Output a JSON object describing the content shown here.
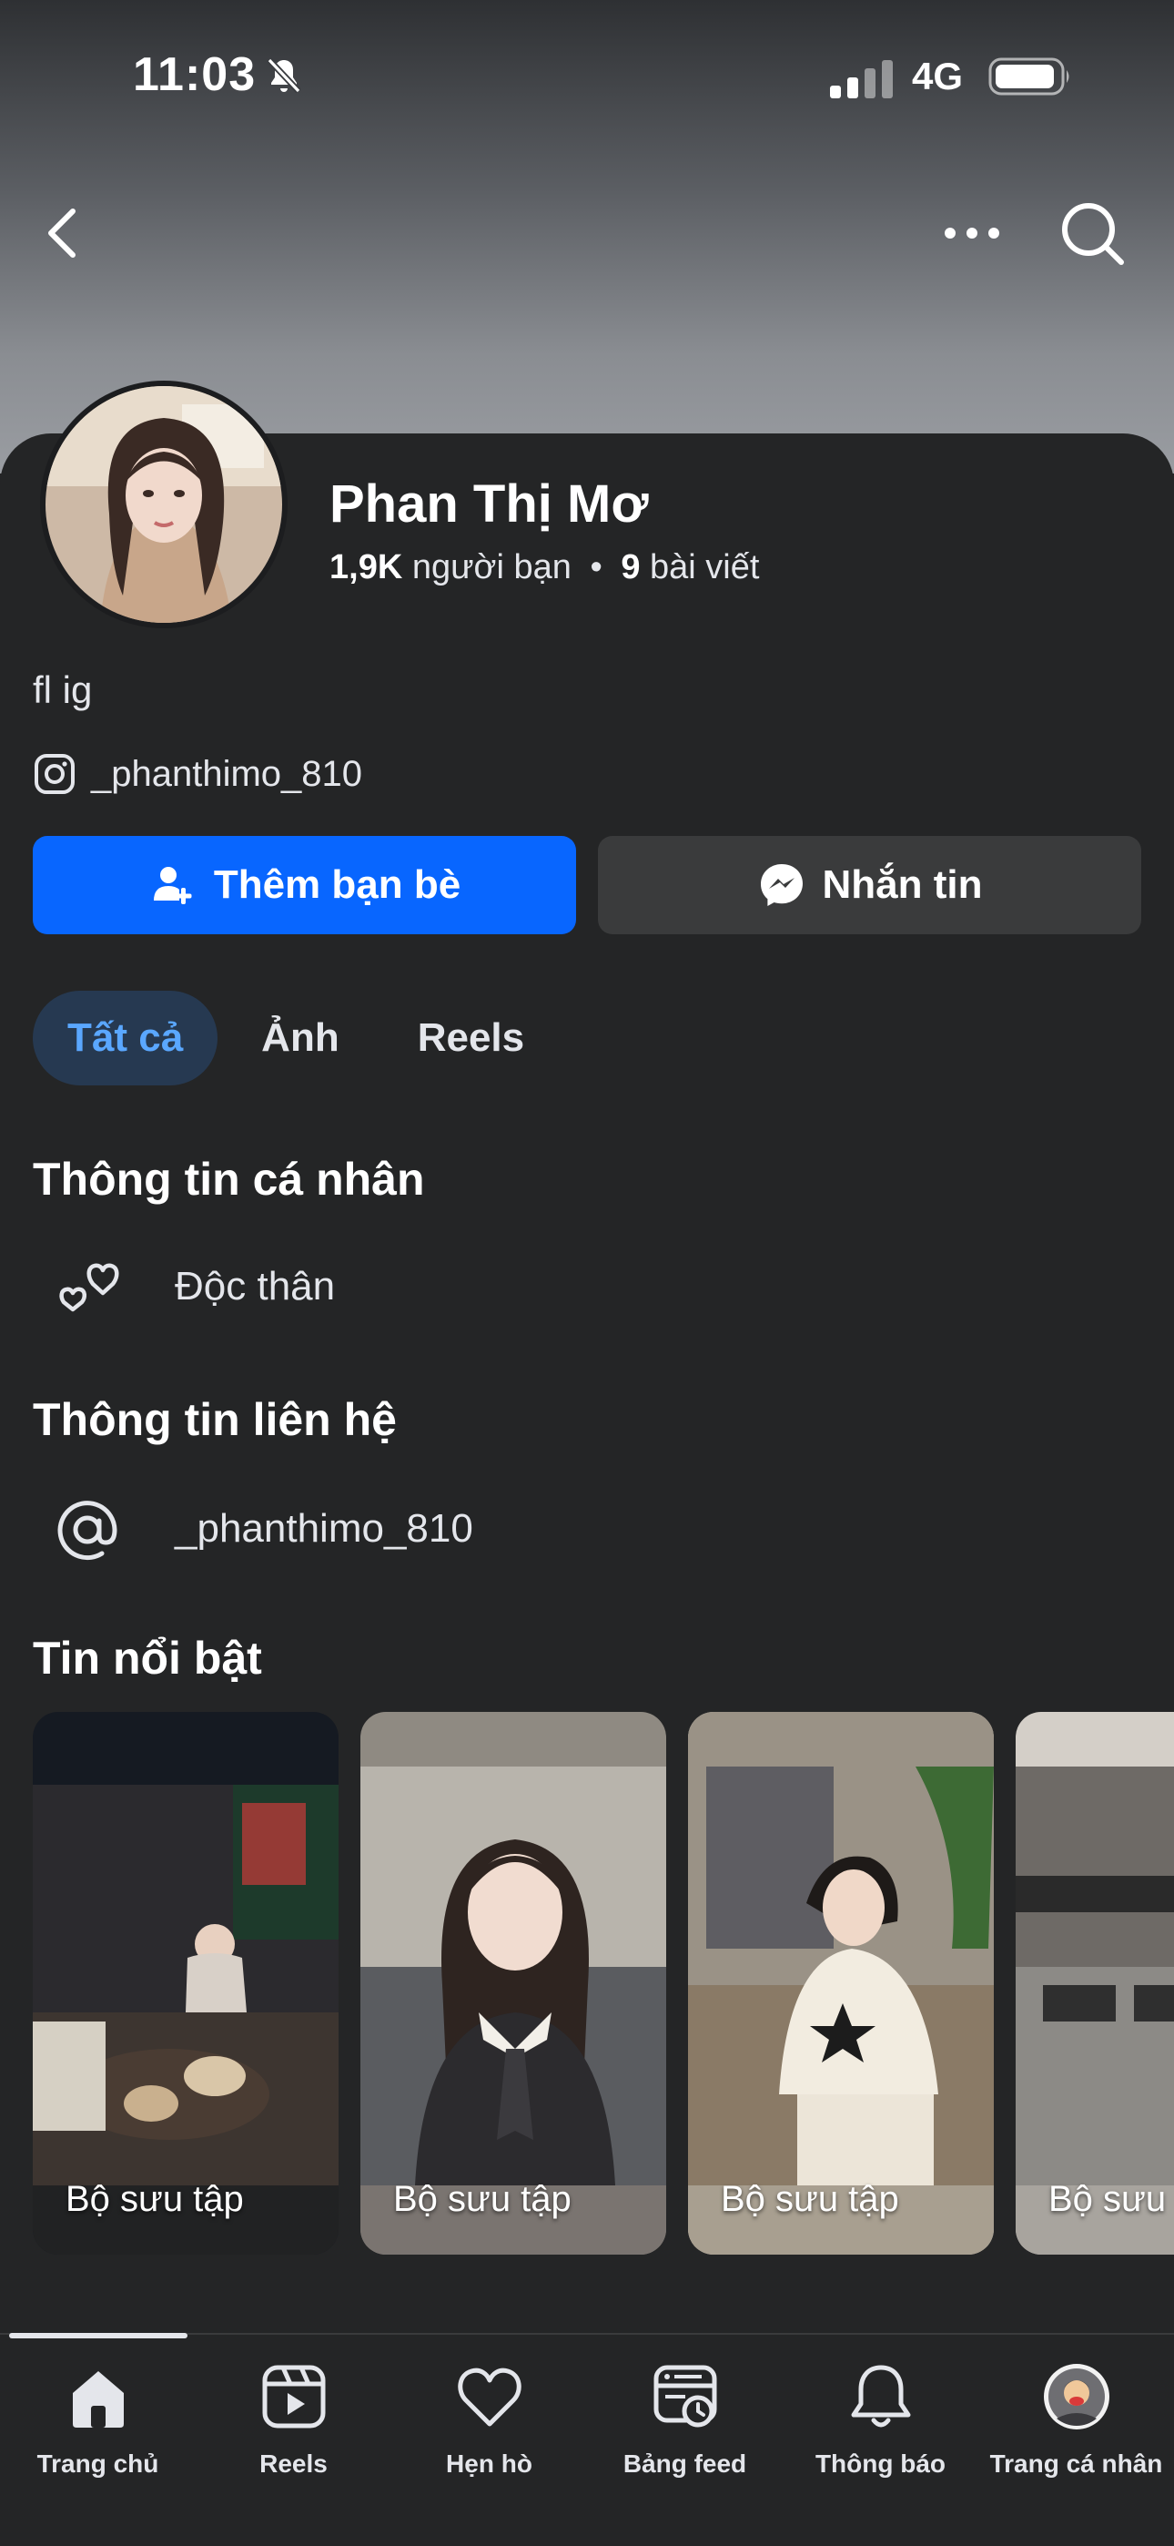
{
  "status_bar": {
    "time": "11:03",
    "network": "4G",
    "icons": [
      "mute-bell-icon",
      "signal-icon",
      "battery-icon"
    ]
  },
  "header": {
    "back_icon": "chevron-left-icon",
    "more_icon": "ellipsis-icon",
    "search_icon": "search-icon"
  },
  "profile": {
    "name": "Phan Thị Mơ",
    "friends_count": "1,9K",
    "friends_label": "người bạn",
    "separator": "•",
    "posts_count": "9",
    "posts_label": "bài viết",
    "bio": "fl ig",
    "instagram_handle": "_phanthimo_810"
  },
  "actions": {
    "add_friend": "Thêm bạn bè",
    "message": "Nhắn tin"
  },
  "tabs": [
    {
      "label": "Tất cả",
      "active": true
    },
    {
      "label": "Ảnh",
      "active": false
    },
    {
      "label": "Reels",
      "active": false
    }
  ],
  "personal_info": {
    "title": "Thông tin cá nhân",
    "relationship": "Độc thân"
  },
  "contact_info": {
    "title": "Thông tin liên hệ",
    "handle": "_phanthimo_810"
  },
  "highlights": {
    "title": "Tin nổi bật",
    "items": [
      {
        "label": "Bộ sưu tập"
      },
      {
        "label": "Bộ sưu tập"
      },
      {
        "label": "Bộ sưu tập"
      },
      {
        "label": "Bộ sưu"
      }
    ]
  },
  "bottom_nav": [
    {
      "label": "Trang chủ",
      "icon": "home-icon",
      "active": true
    },
    {
      "label": "Reels",
      "icon": "reels-icon",
      "active": false
    },
    {
      "label": "Hẹn hò",
      "icon": "heart-icon",
      "active": false
    },
    {
      "label": "Bảng feed",
      "icon": "feed-icon",
      "active": false
    },
    {
      "label": "Thông báo",
      "icon": "bell-icon",
      "active": false
    },
    {
      "label": "Trang cá nhân",
      "icon": "profile-avatar-icon",
      "active": false
    }
  ],
  "colors": {
    "background": "#242526",
    "primary": "#0866ff",
    "secondary_button": "#3a3b3c",
    "active_tab_bg": "#263951",
    "active_tab_text": "#5aa7ff"
  }
}
